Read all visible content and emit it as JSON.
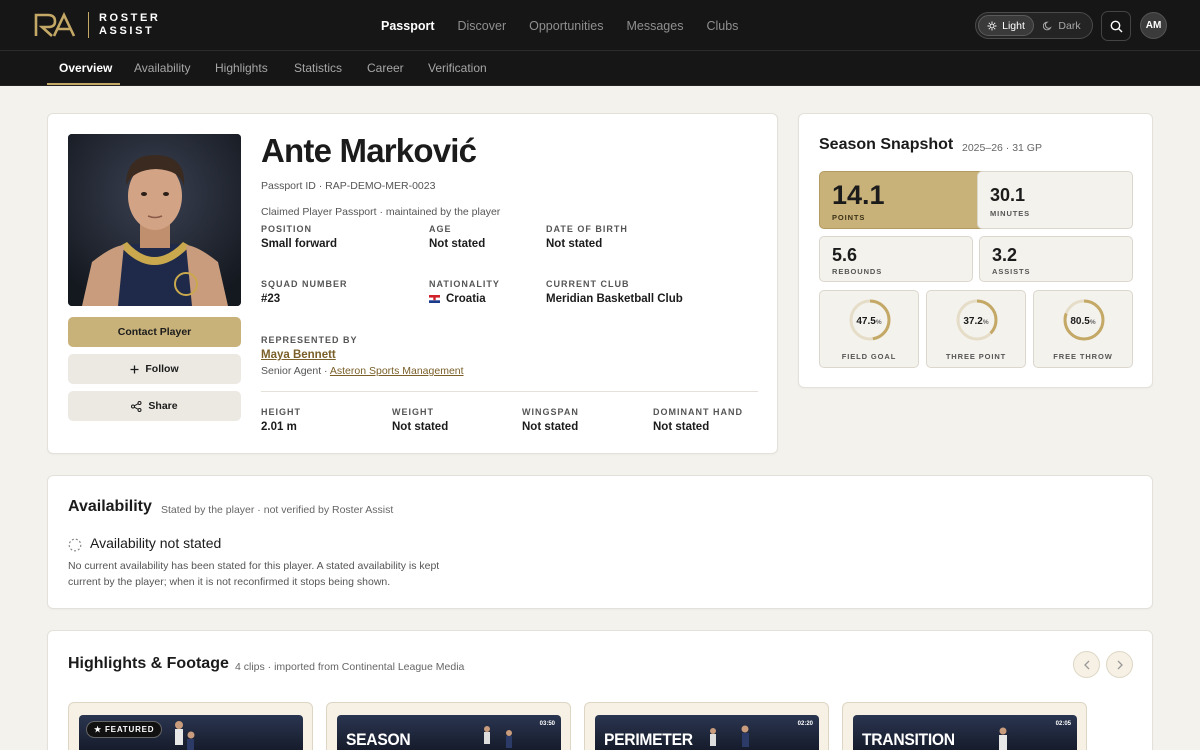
{
  "brand": {
    "line1": "ROSTER",
    "line2": "ASSIST"
  },
  "nav": {
    "items": [
      "Passport",
      "Discover",
      "Opportunities",
      "Messages",
      "Clubs"
    ],
    "active": "Passport"
  },
  "theme": {
    "light": "Light",
    "dark": "Dark",
    "selected": "Light"
  },
  "user": {
    "initials": "AM"
  },
  "subnav": {
    "items": [
      "Overview",
      "Availability",
      "Highlights",
      "Statistics",
      "Career",
      "Verification"
    ],
    "active": "Overview"
  },
  "actions": {
    "contact": "Contact Player",
    "follow": "Follow",
    "share": "Share"
  },
  "player": {
    "name": "Ante Marković",
    "passport_id": "Passport ID · RAP-DEMO-MER-0023",
    "claim_note": "Claimed Player Passport · maintained by the player",
    "fields": {
      "position": {
        "label": "POSITION",
        "value": "Small forward"
      },
      "age": {
        "label": "AGE",
        "value": "Not stated"
      },
      "dob": {
        "label": "DATE OF BIRTH",
        "value": "Not stated"
      },
      "squad": {
        "label": "SQUAD NUMBER",
        "value": "#23"
      },
      "nationality": {
        "label": "NATIONALITY",
        "value": "Croatia"
      },
      "club": {
        "label": "CURRENT CLUB",
        "value": "Meridian Basketball Club"
      }
    },
    "representation": {
      "label": "REPRESENTED BY",
      "agent": "Maya Bennett",
      "role": "Senior Agent · ",
      "agency": "Asteron Sports Management"
    },
    "physical": {
      "height": {
        "label": "HEIGHT",
        "value": "2.01 m"
      },
      "weight": {
        "label": "WEIGHT",
        "value": "Not stated"
      },
      "wingspan": {
        "label": "WINGSPAN",
        "value": "Not stated"
      },
      "hand": {
        "label": "DOMINANT HAND",
        "value": "Not stated"
      }
    }
  },
  "snapshot": {
    "title": "Season Snapshot",
    "subtitle": "2025–26 · 31 GP",
    "stats": {
      "points": {
        "value": "14.1",
        "label": "POINTS"
      },
      "minutes": {
        "value": "30.1",
        "label": "MINUTES"
      },
      "rebounds": {
        "value": "5.6",
        "label": "REBOUNDS"
      },
      "assists": {
        "value": "3.2",
        "label": "ASSISTS"
      }
    },
    "percentages": [
      {
        "value": "47.5",
        "unit": "%",
        "label": "FIELD GOAL",
        "fraction": 0.475
      },
      {
        "value": "37.2",
        "unit": "%",
        "label": "THREE POINT",
        "fraction": 0.372
      },
      {
        "value": "80.5",
        "unit": "%",
        "label": "FREE THROW",
        "fraction": 0.805
      }
    ]
  },
  "availability": {
    "title": "Availability",
    "subtitle": "Stated by the player · not verified by Roster Assist",
    "status": "Availability not stated",
    "desc_line1": "No current availability has been stated for this player. A stated availability is kept",
    "desc_line2": "current by the player; when it is not reconfirmed it stops being shown."
  },
  "highlights": {
    "title": "Highlights & Footage",
    "subtitle": "4 clips · imported from Continental League Media",
    "featured_badge": "FEATURED",
    "clips": [
      {
        "title": "",
        "duration": ""
      },
      {
        "title": "SEASON",
        "duration": "03:50"
      },
      {
        "title": "PERIMETER",
        "duration": "02:20"
      },
      {
        "title": "TRANSITION",
        "duration": "02:05"
      }
    ]
  }
}
